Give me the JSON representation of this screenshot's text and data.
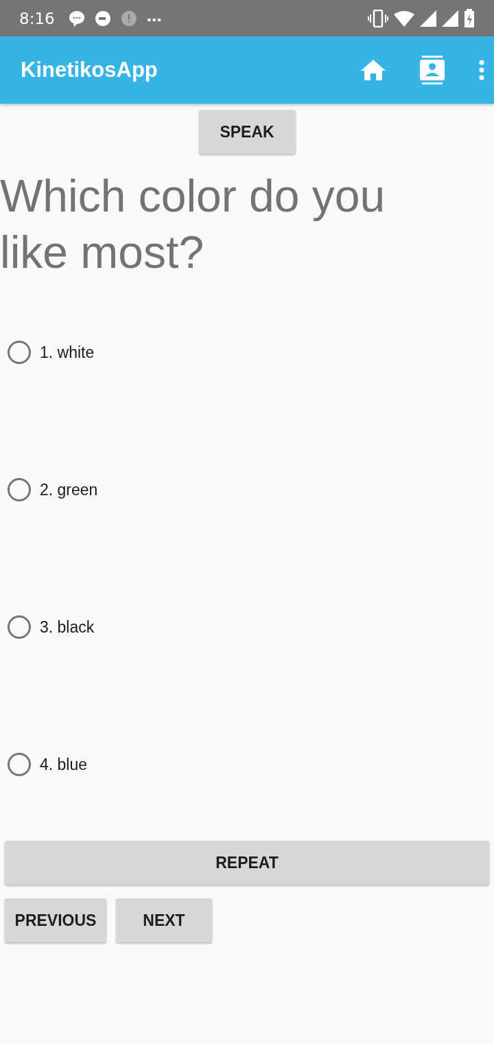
{
  "status_bar": {
    "time": "8:16",
    "overflow": "…"
  },
  "app_bar": {
    "title": "KinetikosApp"
  },
  "speak_button": "SPEAK",
  "question": "Which color do you like most?",
  "options": [
    {
      "label": "1. white",
      "selected": false
    },
    {
      "label": "2. green",
      "selected": false
    },
    {
      "label": "3. black",
      "selected": false
    },
    {
      "label": "4. blue",
      "selected": false
    }
  ],
  "repeat_button": "REPEAT",
  "nav_buttons": [
    "PREVIOUS",
    "NEXT"
  ]
}
